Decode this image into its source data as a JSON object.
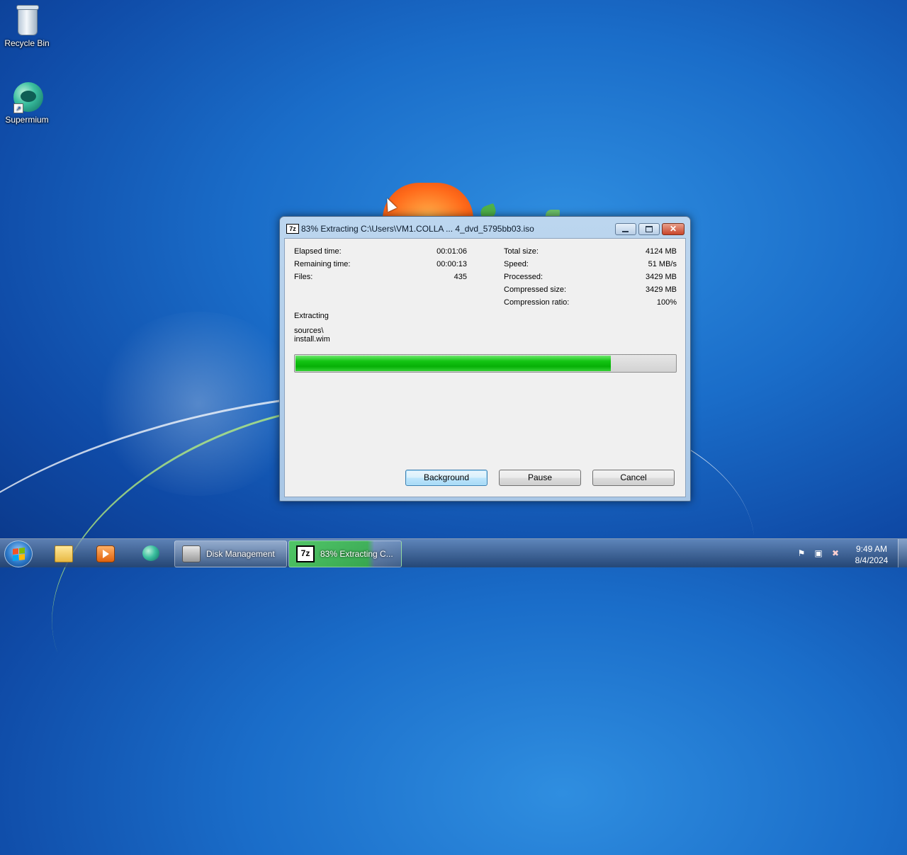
{
  "desktop": {
    "icons": [
      {
        "label": "Recycle Bin",
        "icon": "recycle-bin-icon"
      },
      {
        "label": "Supermium",
        "icon": "supermium-icon"
      }
    ]
  },
  "dialog": {
    "app_icon_text": "7z",
    "title": "83% Extracting C:\\Users\\VM1.COLLA ... 4_dvd_5795bb03.iso",
    "progress_percent": 83,
    "left_stats": [
      {
        "label": "Elapsed time:",
        "value": "00:01:06"
      },
      {
        "label": "Remaining time:",
        "value": "00:00:13"
      },
      {
        "label": "Files:",
        "value": "435"
      }
    ],
    "right_stats": [
      {
        "label": "Total size:",
        "value": "4124 MB"
      },
      {
        "label": "Speed:",
        "value": "51 MB/s"
      },
      {
        "label": "Processed:",
        "value": "3429 MB"
      },
      {
        "label": "Compressed size:",
        "value": "3429 MB"
      },
      {
        "label": "Compression ratio:",
        "value": "100%"
      }
    ],
    "operation": "Extracting",
    "current_path_line1": "sources\\",
    "current_path_line2": "install.wim",
    "buttons": {
      "background": "Background",
      "pause": "Pause",
      "cancel": "Cancel"
    }
  },
  "taskbar": {
    "pinned": [
      "windows-explorer-icon",
      "media-player-icon",
      "supermium-icon"
    ],
    "tasks": [
      {
        "label": "Disk Management",
        "icon": "disk-management-icon"
      },
      {
        "label": "83% Extracting C...",
        "icon": "7zip-icon",
        "icon_text": "7z"
      }
    ],
    "clock": {
      "time": "9:49 AM",
      "date": "8/4/2024"
    }
  },
  "colors": {
    "progress_green": "#06b006",
    "desktop_blue": "#1a6dc9"
  }
}
